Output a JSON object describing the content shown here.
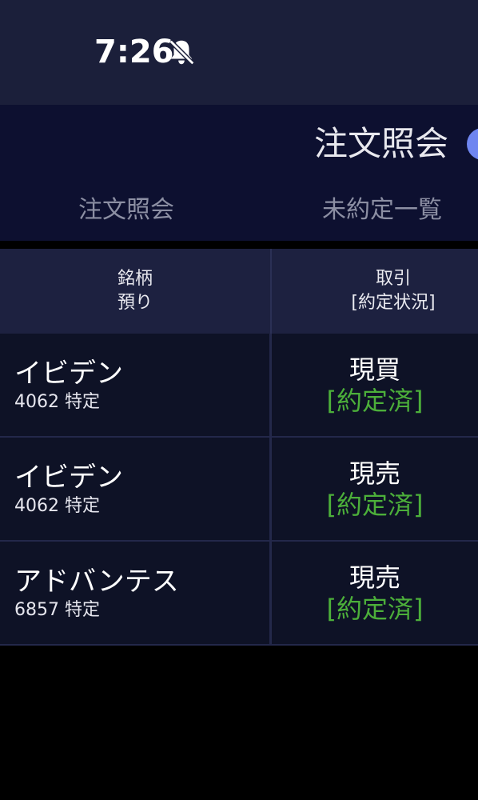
{
  "status_bar": {
    "time": "7:26",
    "icon": "bell-slash-icon"
  },
  "header": {
    "title": "注文照会"
  },
  "tabs": [
    {
      "label": "注文照会"
    },
    {
      "label": "未約定一覧"
    }
  ],
  "table": {
    "columns": [
      {
        "line1": "銘柄",
        "line2": "預り"
      },
      {
        "line1": "取引",
        "line2": "[約定状況]"
      }
    ],
    "rows": [
      {
        "name": "イビデン",
        "sub": "4062 特定",
        "trade": "現買",
        "status": "[約定済]"
      },
      {
        "name": "イビデン",
        "sub": "4062 特定",
        "trade": "現売",
        "status": "[約定済]"
      },
      {
        "name": "アドバンテス",
        "sub": "6857 特定",
        "trade": "現売",
        "status": "[約定済]"
      }
    ]
  },
  "colors": {
    "status_bar_bg": "#1b1f3a",
    "header_bg": "#0d1030",
    "table_header_bg": "#1d2140",
    "row_bg": "#0e1226",
    "status_green": "#4caf3a",
    "accent_dot": "#6f86f0"
  }
}
